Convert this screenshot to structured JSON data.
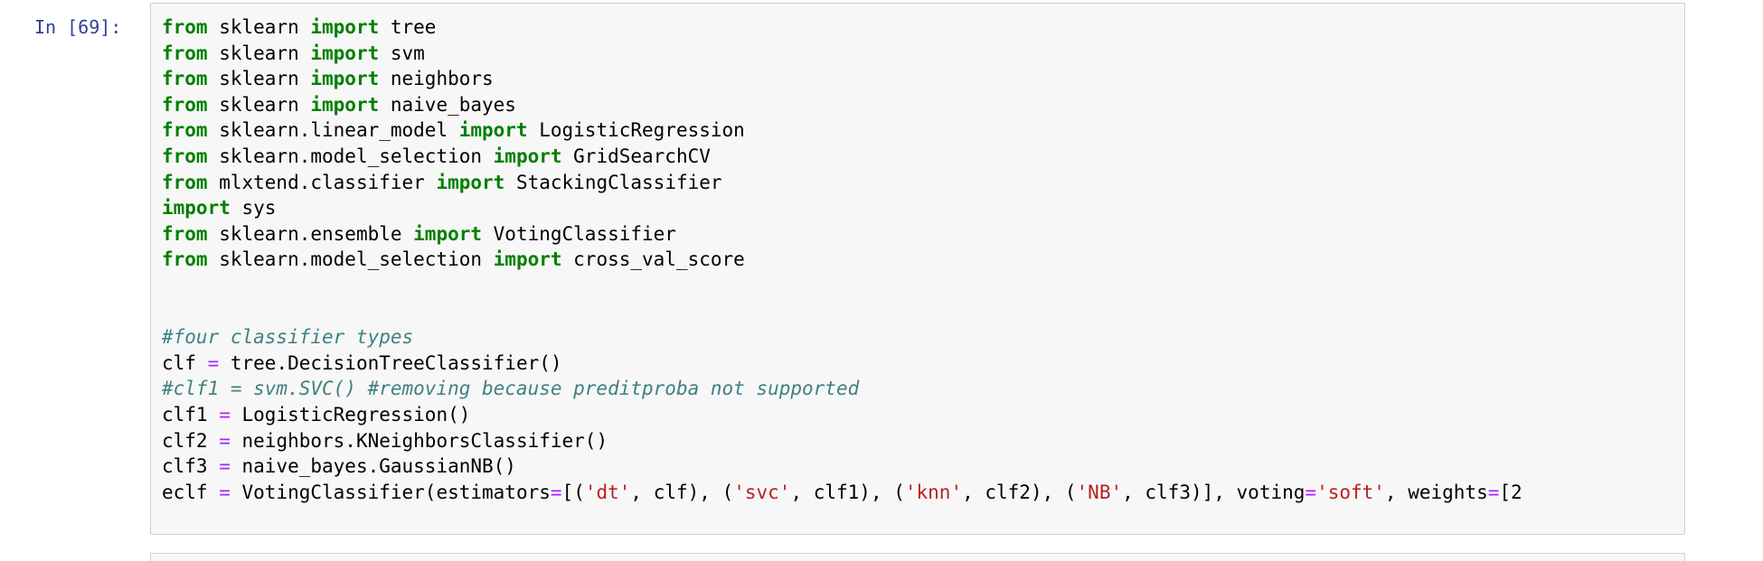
{
  "cell": {
    "prompt": "In [69]:",
    "lines": [
      [
        {
          "t": "kw",
          "v": "from"
        },
        {
          "t": "plain",
          "v": " sklearn "
        },
        {
          "t": "kw",
          "v": "import"
        },
        {
          "t": "plain",
          "v": " tree"
        }
      ],
      [
        {
          "t": "kw",
          "v": "from"
        },
        {
          "t": "plain",
          "v": " sklearn "
        },
        {
          "t": "kw",
          "v": "import"
        },
        {
          "t": "plain",
          "v": " svm"
        }
      ],
      [
        {
          "t": "kw",
          "v": "from"
        },
        {
          "t": "plain",
          "v": " sklearn "
        },
        {
          "t": "kw",
          "v": "import"
        },
        {
          "t": "plain",
          "v": " neighbors"
        }
      ],
      [
        {
          "t": "kw",
          "v": "from"
        },
        {
          "t": "plain",
          "v": " sklearn "
        },
        {
          "t": "kw",
          "v": "import"
        },
        {
          "t": "plain",
          "v": " naive_bayes"
        }
      ],
      [
        {
          "t": "kw",
          "v": "from"
        },
        {
          "t": "plain",
          "v": " sklearn.linear_model "
        },
        {
          "t": "kw",
          "v": "import"
        },
        {
          "t": "plain",
          "v": " LogisticRegression"
        }
      ],
      [
        {
          "t": "kw",
          "v": "from"
        },
        {
          "t": "plain",
          "v": " sklearn.model_selection "
        },
        {
          "t": "kw",
          "v": "import"
        },
        {
          "t": "plain",
          "v": " GridSearchCV"
        }
      ],
      [
        {
          "t": "kw",
          "v": "from"
        },
        {
          "t": "plain",
          "v": " mlxtend.classifier "
        },
        {
          "t": "kw",
          "v": "import"
        },
        {
          "t": "plain",
          "v": " StackingClassifier"
        }
      ],
      [
        {
          "t": "kw",
          "v": "import"
        },
        {
          "t": "plain",
          "v": " sys"
        }
      ],
      [
        {
          "t": "kw",
          "v": "from"
        },
        {
          "t": "plain",
          "v": " sklearn.ensemble "
        },
        {
          "t": "kw",
          "v": "import"
        },
        {
          "t": "plain",
          "v": " VotingClassifier"
        }
      ],
      [
        {
          "t": "kw",
          "v": "from"
        },
        {
          "t": "plain",
          "v": " sklearn.model_selection "
        },
        {
          "t": "kw",
          "v": "import"
        },
        {
          "t": "plain",
          "v": " cross_val_score"
        }
      ],
      [],
      [],
      [
        {
          "t": "cmt",
          "v": "#four classifier types"
        }
      ],
      [
        {
          "t": "plain",
          "v": "clf "
        },
        {
          "t": "op",
          "v": "="
        },
        {
          "t": "plain",
          "v": " tree.DecisionTreeClassifier()"
        }
      ],
      [
        {
          "t": "cmt",
          "v": "#clf1 = svm.SVC() #removing because preditproba not supported"
        }
      ],
      [
        {
          "t": "plain",
          "v": "clf1 "
        },
        {
          "t": "op",
          "v": "="
        },
        {
          "t": "plain",
          "v": " LogisticRegression()"
        }
      ],
      [
        {
          "t": "plain",
          "v": "clf2 "
        },
        {
          "t": "op",
          "v": "="
        },
        {
          "t": "plain",
          "v": " neighbors.KNeighborsClassifier()"
        }
      ],
      [
        {
          "t": "plain",
          "v": "clf3 "
        },
        {
          "t": "op",
          "v": "="
        },
        {
          "t": "plain",
          "v": " naive_bayes.GaussianNB()"
        }
      ],
      [
        {
          "t": "plain",
          "v": "eclf "
        },
        {
          "t": "op",
          "v": "="
        },
        {
          "t": "plain",
          "v": " VotingClassifier(estimators"
        },
        {
          "t": "op",
          "v": "="
        },
        {
          "t": "plain",
          "v": "[("
        },
        {
          "t": "str",
          "v": "'dt'"
        },
        {
          "t": "plain",
          "v": ", clf), ("
        },
        {
          "t": "str",
          "v": "'svc'"
        },
        {
          "t": "plain",
          "v": ", clf1), ("
        },
        {
          "t": "str",
          "v": "'knn'"
        },
        {
          "t": "plain",
          "v": ", clf2), ("
        },
        {
          "t": "str",
          "v": "'NB'"
        },
        {
          "t": "plain",
          "v": ", clf3)], voting"
        },
        {
          "t": "op",
          "v": "="
        },
        {
          "t": "str",
          "v": "'soft'"
        },
        {
          "t": "plain",
          "v": ", weights"
        },
        {
          "t": "op",
          "v": "="
        },
        {
          "t": "plain",
          "v": "[2"
        }
      ]
    ]
  },
  "colors": {
    "keyword": "#008000",
    "string": "#ba2121",
    "comment": "#408080",
    "operator": "#aa22ff",
    "prompt": "#303f9f",
    "cell_background": "#f7f7f7",
    "cell_border": "#cfcfcf"
  }
}
